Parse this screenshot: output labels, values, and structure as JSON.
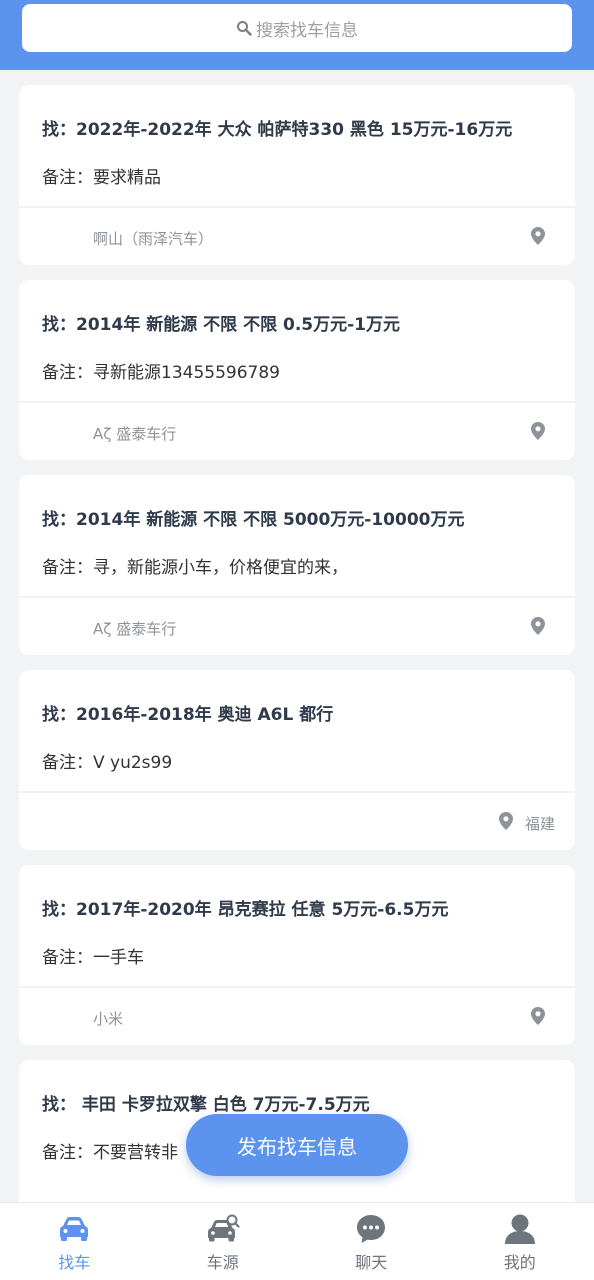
{
  "search": {
    "placeholder": "搜索找车信息"
  },
  "listings": [
    {
      "title": "找：2022年-2022年 大众 帕萨特330 黑色 15万元-16万元",
      "note": "备注：要求精品",
      "shop": "啊山（雨泽汽车）",
      "place": ""
    },
    {
      "title": "找：2014年 新能源 不限 不限 0.5万元-1万元",
      "note": "备注：寻新能源13455596789",
      "shop": "Aζ 盛泰车行",
      "place": ""
    },
    {
      "title": "找：2014年 新能源 不限 不限 5000万元-10000万元",
      "note": "备注：寻，新能源小车，价格便宜的来，",
      "shop": "Aζ 盛泰车行",
      "place": ""
    },
    {
      "title": "找：2016年-2018年 奥迪 A6L 都行",
      "note": "备注：V  yu2s99",
      "shop": "",
      "place": "福建"
    },
    {
      "title": "找：2017年-2020年 昂克赛拉 任意 5万元-6.5万元",
      "note": "备注：一手车",
      "shop": "小米",
      "place": ""
    },
    {
      "title": "找：  丰田 卡罗拉双擎 白色 7万元-7.5万元",
      "note": "备注：不要营转非",
      "shop": "",
      "place": ""
    }
  ],
  "fab": {
    "label": "发布找车信息"
  },
  "tabs": [
    {
      "label": "找车",
      "active": true
    },
    {
      "label": "车源",
      "active": false
    },
    {
      "label": "聊天",
      "active": false
    },
    {
      "label": "我的",
      "active": false
    }
  ],
  "colors": {
    "accent": "#5b93ee",
    "icon_gray": "#8e939a"
  }
}
